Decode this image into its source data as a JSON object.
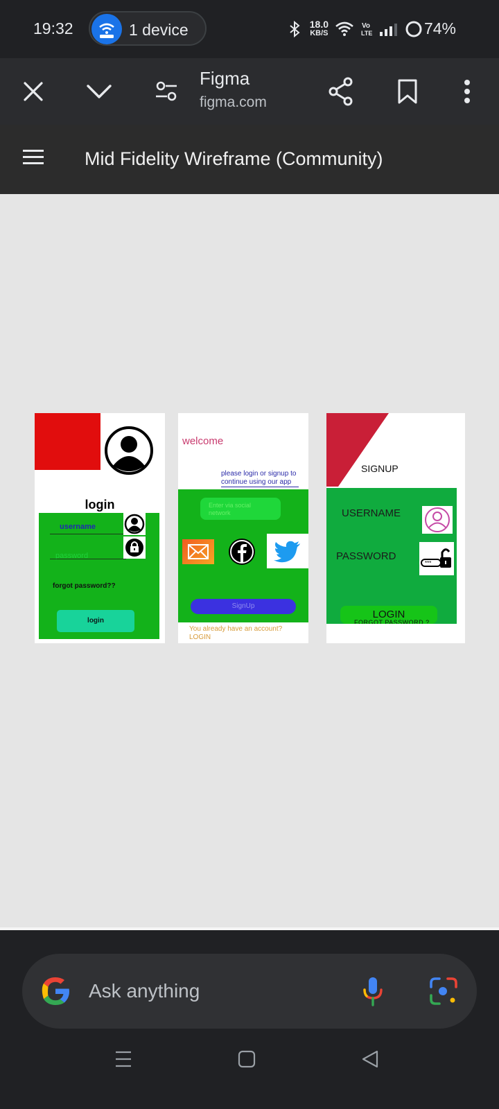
{
  "status_bar": {
    "time": "19:32",
    "hotspot_label": "1 device",
    "net_speed_value": "18.0",
    "net_speed_unit": "KB/S",
    "battery": "74%"
  },
  "browser": {
    "title": "Figma",
    "url": "figma.com"
  },
  "figma": {
    "file_title": "Mid Fidelity Wireframe (Community)"
  },
  "frames": {
    "login": {
      "title": "login",
      "username": "username",
      "password": "password",
      "forgot": "forgot password??",
      "button": "login"
    },
    "welcome": {
      "title": "welcome",
      "subtitle_line1": "please login or signup to",
      "subtitle_line2": "continue using our app",
      "social_line1": "Enter via social",
      "social_line2": "network",
      "signup_button": "SignUp",
      "already_line1": "You already have an account?",
      "already_line2": "LOGIN"
    },
    "signup": {
      "title": "SIGNUP",
      "username": "USERNAME",
      "password": "PASSWORD",
      "login_button": "LOGIN",
      "forgot": "FORGOT PASSWORD ?"
    }
  },
  "search": {
    "placeholder": "Ask anything"
  },
  "colors": {
    "accent_blue": "#1a73e8",
    "wireframe_green": "#13b21a",
    "wireframe_red": "#e10d0d"
  }
}
